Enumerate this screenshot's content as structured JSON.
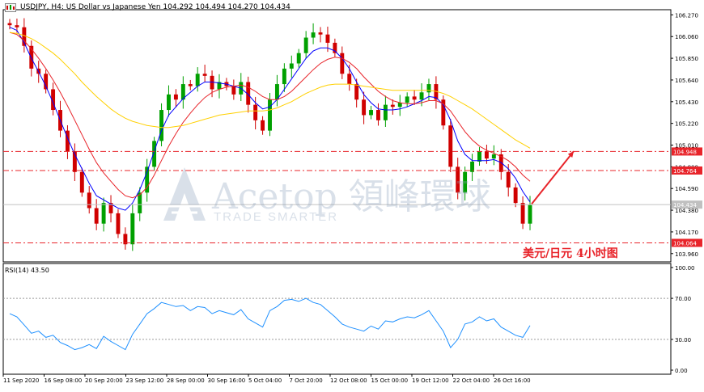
{
  "header": {
    "title": "USDJPY, H4:  US Dollar vs Japanese Yen  104.292 104.494 104.270 104.434"
  },
  "rsi_header": "RSI(14) 43.50",
  "caption": "美元/日元  4小时图",
  "watermark": {
    "brand": "Acetop 領峰環球",
    "tagline": "TRADE SMARTER"
  },
  "colors": {
    "candle_up": "#00a000",
    "candle_down": "#d00000",
    "ma_fast": "#0000ff",
    "ma_mid": "#e8242a",
    "ma_slow": "#ffd000",
    "level_line": "#e8242a",
    "level_label_bg": "#e8242a",
    "rsi_line": "#1e90ff",
    "arrow": "#e8242a"
  },
  "chart_data": [
    {
      "type": "candlestick",
      "title": "USDJPY, H4",
      "price_axis_ticks": [
        "106.270",
        "106.060",
        "105.850",
        "105.640",
        "105.430",
        "105.220",
        "105.010",
        "104.800",
        "104.590",
        "104.380",
        "104.170",
        "103.960"
      ],
      "x_tick_labels": [
        "11 Sep 2020",
        "16 Sep 08:00",
        "20 Sep 20:00",
        "23 Sep 12:00",
        "28 Sep 00:00",
        "30 Sep 16:00",
        "5 Oct 04:00",
        "7 Oct 20:00",
        "12 Oct 08:00",
        "15 Oct 00:00",
        "19 Oct 12:00",
        "22 Oct 04:00",
        "26 Oct 16:00"
      ],
      "ylim": [
        103.88,
        106.32
      ],
      "current_price_label": "104.434",
      "levels": [
        {
          "value": 104.948,
          "label": "104.948"
        },
        {
          "value": 104.764,
          "label": "104.764"
        },
        {
          "value": 104.064,
          "label": "104.064"
        }
      ],
      "close_path": [
        106.17,
        106.15,
        105.97,
        105.75,
        105.7,
        105.55,
        105.35,
        105.15,
        104.95,
        104.75,
        104.55,
        104.4,
        104.25,
        104.45,
        104.35,
        104.15,
        104.05,
        104.35,
        104.55,
        104.8,
        105.05,
        105.35,
        105.5,
        105.45,
        105.6,
        105.58,
        105.7,
        105.68,
        105.55,
        105.62,
        105.58,
        105.5,
        105.62,
        105.4,
        105.25,
        105.15,
        105.45,
        105.6,
        105.75,
        105.8,
        105.9,
        106.05,
        106.1,
        106.08,
        106.0,
        105.9,
        105.7,
        105.6,
        105.45,
        105.3,
        105.35,
        105.25,
        105.4,
        105.38,
        105.42,
        105.48,
        105.45,
        105.52,
        105.6,
        105.45,
        105.2,
        104.8,
        104.55,
        104.75,
        104.85,
        104.95,
        104.88,
        104.92,
        104.75,
        104.6,
        104.45,
        104.25,
        104.43
      ],
      "moving_averages": [
        {
          "name": "MA fast",
          "color": "#0000ff",
          "values": [
            106.15,
            106.12,
            106.0,
            105.85,
            105.72,
            105.58,
            105.42,
            105.25,
            105.08,
            104.92,
            104.78,
            104.64,
            104.52,
            104.48,
            104.44,
            104.4,
            104.38,
            104.45,
            104.58,
            104.75,
            104.95,
            105.15,
            105.3,
            105.38,
            105.46,
            105.52,
            105.58,
            105.62,
            105.62,
            105.61,
            105.6,
            105.58,
            105.56,
            105.5,
            105.42,
            105.36,
            105.38,
            105.45,
            105.55,
            105.65,
            105.75,
            105.85,
            105.92,
            105.95,
            105.95,
            105.92,
            105.85,
            105.75,
            105.62,
            105.5,
            105.42,
            105.36,
            105.35,
            105.35,
            105.36,
            105.38,
            105.41,
            105.44,
            105.48,
            105.47,
            105.4,
            105.25,
            105.05,
            104.92,
            104.86,
            104.86,
            104.86,
            104.87,
            104.84,
            104.78,
            104.69,
            104.56,
            104.46
          ]
        },
        {
          "name": "MA mid",
          "color": "#e8242a",
          "values": [
            106.1,
            106.08,
            106.02,
            105.94,
            105.85,
            105.75,
            105.64,
            105.52,
            105.39,
            105.25,
            105.11,
            104.97,
            104.84,
            104.74,
            104.66,
            104.58,
            104.52,
            104.5,
            104.53,
            104.6,
            104.72,
            104.86,
            105.0,
            105.12,
            105.23,
            105.32,
            105.4,
            105.47,
            105.52,
            105.55,
            105.57,
            105.58,
            105.59,
            105.57,
            105.53,
            105.48,
            105.45,
            105.45,
            105.48,
            105.53,
            105.6,
            105.67,
            105.74,
            105.8,
            105.84,
            105.86,
            105.85,
            105.81,
            105.75,
            105.67,
            105.6,
            105.53,
            105.48,
            105.44,
            105.42,
            105.41,
            105.41,
            105.42,
            105.44,
            105.44,
            105.41,
            105.34,
            105.24,
            105.14,
            105.06,
            105.0,
            104.96,
            104.93,
            104.9,
            104.86,
            104.8,
            104.72,
            104.66
          ]
        },
        {
          "name": "MA slow",
          "color": "#ffd000",
          "values": [
            106.1,
            106.09,
            106.07,
            106.04,
            106.0,
            105.95,
            105.9,
            105.84,
            105.77,
            105.7,
            105.62,
            105.55,
            105.48,
            105.42,
            105.36,
            105.31,
            105.27,
            105.24,
            105.22,
            105.2,
            105.19,
            105.18,
            105.18,
            105.19,
            105.2,
            105.22,
            105.24,
            105.26,
            105.28,
            105.3,
            105.31,
            105.32,
            105.33,
            105.34,
            105.34,
            105.34,
            105.35,
            105.37,
            105.4,
            105.43,
            105.47,
            105.51,
            105.54,
            105.57,
            105.59,
            105.6,
            105.6,
            105.6,
            105.59,
            105.58,
            105.57,
            105.56,
            105.55,
            105.54,
            105.54,
            105.54,
            105.54,
            105.54,
            105.54,
            105.53,
            105.51,
            105.48,
            105.44,
            105.4,
            105.36,
            105.31,
            105.26,
            105.21,
            105.16,
            105.11,
            105.06,
            105.02,
            104.98
          ]
        }
      ],
      "forecast_arrow": {
        "from": 104.44,
        "to": 104.95
      }
    },
    {
      "type": "line",
      "title": "RSI(14)",
      "y_ticks": [
        "100.00",
        "70.00",
        "30.00",
        "0.00"
      ],
      "ylim": [
        0,
        100
      ],
      "guide_levels": [
        70,
        30
      ],
      "values": [
        55,
        52,
        44,
        36,
        38,
        32,
        34,
        27,
        24,
        20,
        22,
        25,
        21,
        33,
        28,
        24,
        20,
        35,
        45,
        55,
        60,
        66,
        64,
        62,
        63,
        58,
        62,
        61,
        55,
        58,
        56,
        54,
        59,
        50,
        46,
        42,
        58,
        62,
        68,
        69,
        67,
        70,
        66,
        64,
        58,
        52,
        45,
        42,
        40,
        38,
        43,
        40,
        48,
        47,
        50,
        52,
        51,
        54,
        58,
        48,
        38,
        22,
        30,
        45,
        47,
        52,
        48,
        50,
        42,
        38,
        34,
        32,
        43.5
      ]
    }
  ]
}
